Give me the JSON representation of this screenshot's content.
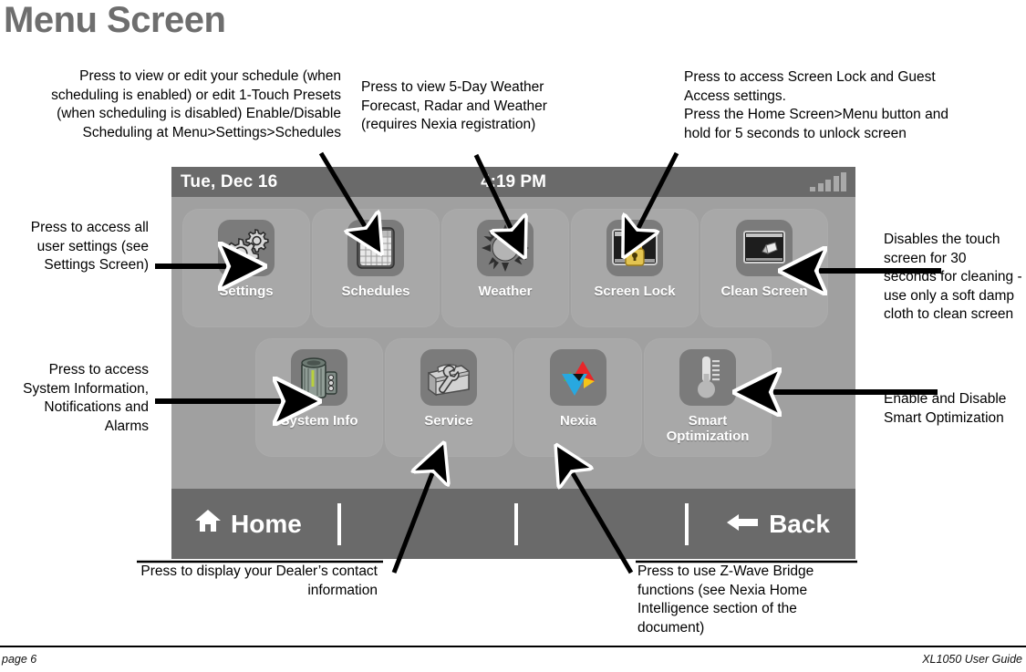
{
  "page": {
    "title": "Menu Screen",
    "footer_left": "page 6",
    "footer_right": "XL1050 User Guide"
  },
  "callouts": {
    "schedules": "Press to view or edit your schedule (when scheduling is enabled) or edit 1-Touch Presets (when scheduling is disabled) Enable/Disable Scheduling at Menu>Settings>Schedules",
    "weather": "Press to view 5-Day Weather Forecast, Radar and Weather (requires Nexia registration)",
    "screen_lock": "Press to access Screen Lock and Guest Access settings.\nPress the Home Screen>Menu button and hold for 5 seconds to unlock screen",
    "settings": "Press to access all user settings (see Settings Screen)",
    "system_info": "Press to access System Information, Notifications and Alarms",
    "clean_screen": "Disables the touch screen for 30 seconds for cleaning - use only a soft damp cloth to clean screen",
    "smart_optimization": "Enable and Disable Smart Optimization",
    "service": "Press to display your Dealer’s contact information",
    "nexia": "Press to use Z-Wave Bridge functions (see Nexia Home Intelligence section of the document)"
  },
  "device": {
    "status": {
      "date": "Tue, Dec 16",
      "time": "4:19 PM",
      "signal_icon": "signal-strength-icon",
      "signal_bars": 5
    },
    "tiles_row1": [
      {
        "label": "Settings",
        "icon": "gears-icon"
      },
      {
        "label": "Schedules",
        "icon": "calendar-icon"
      },
      {
        "label": "Weather",
        "icon": "sun-icon"
      },
      {
        "label": "Screen Lock",
        "icon": "lock-screen-icon"
      },
      {
        "label": "Clean Screen",
        "icon": "clean-screen-icon"
      }
    ],
    "tiles_row2": [
      {
        "label": "System Info",
        "icon": "hvac-unit-icon"
      },
      {
        "label": "Service",
        "icon": "toolbox-wrench-icon"
      },
      {
        "label": "Nexia",
        "icon": "nexia-logo-icon"
      },
      {
        "label": "Smart\nOptimization",
        "icon": "thermometer-icon"
      }
    ],
    "nav": {
      "home_label": "Home",
      "home_icon": "home-icon",
      "back_label": "Back",
      "back_icon": "arrow-left-icon"
    }
  },
  "colors": {
    "title_gray": "#6e6e6e",
    "screen_bg": "#a0a0a0",
    "bar_gray": "#6a6a6a",
    "tile_gray": "#a8a8a8",
    "glyph_gray": "#7b7b7b",
    "lock_gold": "#d9b740",
    "nexia_red": "#e8262a",
    "nexia_blue": "#28a8e0",
    "nexia_green": "#5cb63c",
    "nexia_yellow": "#f5c518"
  }
}
